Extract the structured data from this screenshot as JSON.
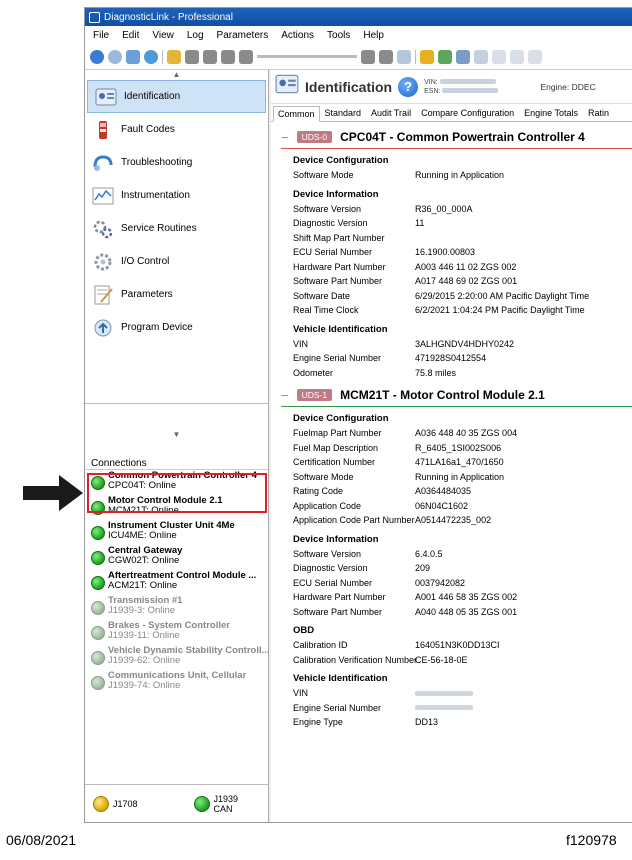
{
  "window": {
    "title": "DiagnosticLink - Professional"
  },
  "menu": [
    "File",
    "Edit",
    "View",
    "Log",
    "Parameters",
    "Actions",
    "Tools",
    "Help"
  ],
  "nav": {
    "items": [
      {
        "label": "Identification",
        "icon": "identification-icon"
      },
      {
        "label": "Fault Codes",
        "icon": "fault-codes-icon"
      },
      {
        "label": "Troubleshooting",
        "icon": "troubleshooting-icon"
      },
      {
        "label": "Instrumentation",
        "icon": "instrumentation-icon"
      },
      {
        "label": "Service Routines",
        "icon": "service-routines-icon"
      },
      {
        "label": "I/O Control",
        "icon": "io-control-icon"
      },
      {
        "label": "Parameters",
        "icon": "parameters-icon"
      },
      {
        "label": "Program Device",
        "icon": "program-device-icon"
      }
    ]
  },
  "connections": {
    "header": "Connections",
    "items": [
      {
        "name": "Common Powertrain Controller 4",
        "sub": "CPC04T: Online",
        "status": "online"
      },
      {
        "name": "Motor Control Module 2.1",
        "sub": "MCM21T: Online",
        "status": "online"
      },
      {
        "name": "Instrument Cluster Unit 4Me",
        "sub": "ICU4ME: Online",
        "status": "online"
      },
      {
        "name": "Central Gateway",
        "sub": "CGW02T: Online",
        "status": "online"
      },
      {
        "name": "Aftertreatment Control Module ...",
        "sub": "ACM21T: Online",
        "status": "online"
      },
      {
        "name": "Transmission #1",
        "sub": "J1939-3: Online",
        "status": "offline"
      },
      {
        "name": "Brakes - System Controller",
        "sub": "J1939-11: Online",
        "status": "offline"
      },
      {
        "name": "Vehicle Dynamic Stability Controll...",
        "sub": "J1939-62: Online",
        "status": "offline"
      },
      {
        "name": "Communications Unit, Cellular",
        "sub": "J1939-74: Online",
        "status": "offline"
      }
    ]
  },
  "bus": {
    "j1708": "J1708",
    "j1939_line1": "J1939",
    "j1939_line2": "CAN"
  },
  "header": {
    "title": "Identification",
    "help": "?",
    "vin_label": "VIN:",
    "esn_label": "ESN:",
    "engine_label": "Engine: DDEC"
  },
  "tabs": [
    "Common",
    "Standard",
    "Audit Trail",
    "Compare Configuration",
    "Engine Totals",
    "Ratin"
  ],
  "sections": [
    {
      "badge": "UDS-0",
      "title": "CPC04T - Common Powertrain Controller 4",
      "accent": "#d9534f",
      "groups": [
        {
          "title": "Device Configuration",
          "rows": [
            {
              "k": "Software Mode",
              "v": "Running in Application"
            }
          ]
        },
        {
          "title": "Device Information",
          "rows": [
            {
              "k": "Software Version",
              "v": "R36_00_000A"
            },
            {
              "k": "Diagnostic Version",
              "v": "11"
            },
            {
              "k": "Shift Map Part Number",
              "v": ""
            },
            {
              "k": "ECU Serial Number",
              "v": "16.1900.00803"
            },
            {
              "k": "Hardware Part Number",
              "v": "A003 446 11 02 ZGS 002"
            },
            {
              "k": "Software Part Number",
              "v": "A017 448 69 02 ZGS 001"
            },
            {
              "k": "Software Date",
              "v": "6/29/2015 2:20:00 AM Pacific Daylight Time"
            },
            {
              "k": "Real Time Clock",
              "v": "6/2/2021 1:04:24 PM Pacific Daylight Time"
            }
          ]
        },
        {
          "title": "Vehicle Identification",
          "rows": [
            {
              "k": "VIN",
              "v": "3ALHGNDV4HDHY0242"
            },
            {
              "k": "Engine Serial Number",
              "v": "471928S0412554"
            },
            {
              "k": "Odometer",
              "v": "75.8 miles"
            }
          ]
        }
      ]
    },
    {
      "badge": "UDS-1",
      "title": "MCM21T - Motor Control Module 2.1",
      "accent": "#2e9b4a",
      "groups": [
        {
          "title": "Device Configuration",
          "rows": [
            {
              "k": "Fuelmap Part Number",
              "v": "A036 448 40 35 ZGS 004"
            },
            {
              "k": "Fuel Map Description",
              "v": "R_6405_1SI002S006"
            },
            {
              "k": "Certification Number",
              "v": "471LA16a1_470/1650"
            },
            {
              "k": "Software Mode",
              "v": "Running in Application"
            },
            {
              "k": "Rating Code",
              "v": "A0364484035"
            },
            {
              "k": "Application Code",
              "v": "06N04C1602"
            },
            {
              "k": "Application Code Part Number",
              "v": "A0514472235_002"
            }
          ]
        },
        {
          "title": "Device Information",
          "rows": [
            {
              "k": "Software Version",
              "v": "6.4.0.5"
            },
            {
              "k": "Diagnostic Version",
              "v": "209"
            },
            {
              "k": "ECU Serial Number",
              "v": "0037942082"
            },
            {
              "k": "Hardware Part Number",
              "v": "A001 446 58 35 ZGS 002"
            },
            {
              "k": "Software Part Number",
              "v": "A040 448 05 35 ZGS 001"
            }
          ]
        },
        {
          "title": "OBD",
          "rows": [
            {
              "k": "Calibration ID",
              "v": "164051N3K0DD13CI"
            },
            {
              "k": "Calibration Verification Number",
              "v": "CE-56-18-0E"
            }
          ]
        },
        {
          "title": "Vehicle Identification",
          "rows": [
            {
              "k": "VIN",
              "v": ""
            },
            {
              "k": "Engine Serial Number",
              "v": ""
            },
            {
              "k": "Engine Type",
              "v": "DD13"
            }
          ]
        }
      ]
    }
  ],
  "footer": {
    "date": "06/08/2021",
    "figure": "f120978"
  }
}
